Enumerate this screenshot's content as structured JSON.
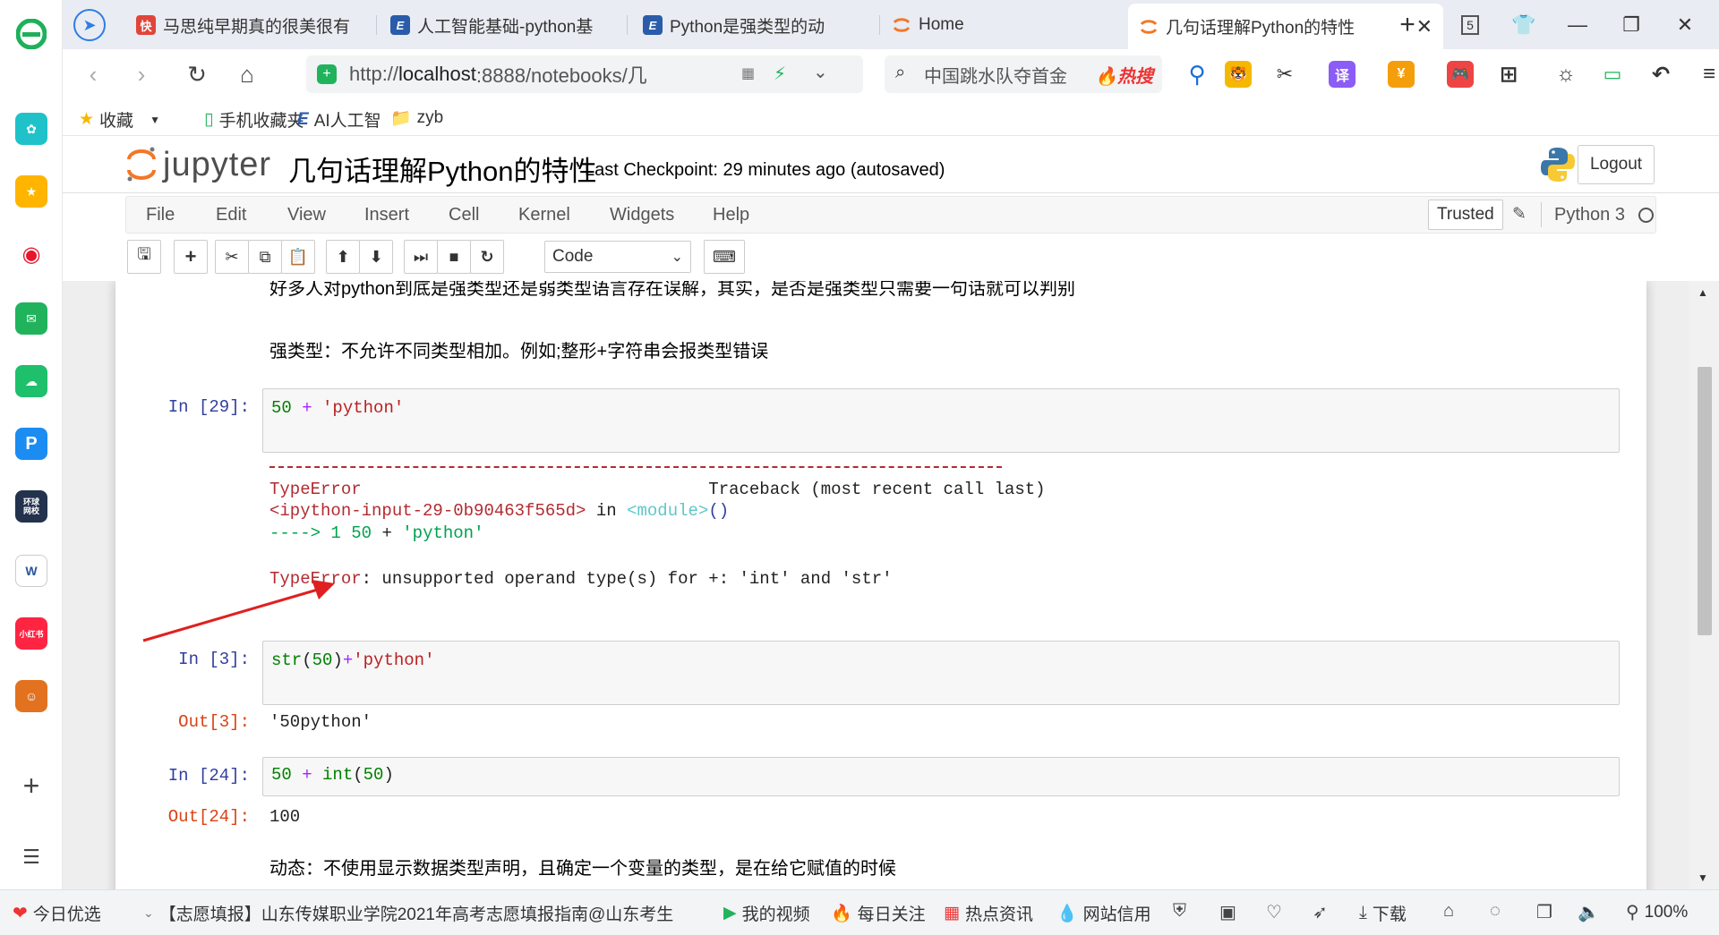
{
  "sidebar": {
    "icons": [
      "browser-logo-icon",
      "mini-program-icon",
      "favorites-star-icon",
      "weibo-icon",
      "mail-icon",
      "cloud-icon",
      "p-app-icon",
      "global-news-icon",
      "document-icon",
      "xiaohongshu-icon",
      "game-avatar-icon",
      "add-icon",
      "list-icon"
    ],
    "global_news_label": "环球\n网校",
    "xiaohongshu_label": "小红书"
  },
  "tabs": [
    {
      "label": "马思纯早期真的很美很有",
      "fav_color": "#e0453a",
      "fav_text": "快"
    },
    {
      "label": "人工智能基础-python基",
      "fav_color": "#2a5caa",
      "fav_text": "E"
    },
    {
      "label": "Python是强类型的动",
      "fav_color": "#2a5caa",
      "fav_text": "E"
    },
    {
      "label": "Home",
      "fav_color": "#f37726",
      "fav_text": ""
    },
    {
      "label": "几句话理解Python的特性",
      "fav_color": "#f37726",
      "fav_text": ""
    }
  ],
  "tab_count": "5",
  "nav": {
    "url_prefix": "http://",
    "url_host": "localhost",
    "url_rest": ":8888/notebooks/几",
    "search_text": "中国跳水队夺首金",
    "hot_label": "热搜"
  },
  "bookmarks": {
    "favorites": "收藏",
    "mobile": "手机收藏夹",
    "ai": "AI人工智",
    "folder": "zyb"
  },
  "jupyter": {
    "logo": "jupyter",
    "notebook_title": "几句话理解Python的特性",
    "checkpoint": "Last Checkpoint: 29 minutes ago (autosaved)",
    "logout": "Logout",
    "menus": [
      "File",
      "Edit",
      "View",
      "Insert",
      "Cell",
      "Kernel",
      "Widgets",
      "Help"
    ],
    "trusted": "Trusted",
    "kernel": "Python 3",
    "cell_type": "Code"
  },
  "cells": {
    "md1": "好多人对python到底是强类型还是弱类型语言存在误解，其实，是否是强类型只需要一句话就可以判别",
    "md2": "强类型：不允许不同类型相加。例如;整形+字符串会报类型错误",
    "c1_prompt": "In  [29]:",
    "c1_num": "50",
    "c1_op": "+",
    "c1_str": "'python'",
    "err_name": "TypeError",
    "err_traceback": "Traceback (most recent call last)",
    "err_input": "<ipython-input-29-0b90463f565d>",
    "err_in": "in",
    "err_module": "<module>",
    "err_parens": "()",
    "err_arrow": "----> 1",
    "err_line_num": "50",
    "err_line_op": "+",
    "err_line_str": "'python'",
    "err_final_name": "TypeError",
    "err_final_msg": ": unsupported operand type(s) for +: 'int' and 'str'",
    "c2_prompt": "In  [3]:",
    "c2_func": "str",
    "c2_open": "(",
    "c2_num": "50",
    "c2_close": ")",
    "c2_op": "+",
    "c2_str": "'python'",
    "c2_out_prompt": "Out[3]:",
    "c2_out": "'50python'",
    "c3_prompt": "In  [24]:",
    "c3_num": "50",
    "c3_op": "+",
    "c3_func": "int",
    "c3_open": "(",
    "c3_arg": "50",
    "c3_close": ")",
    "c3_out_prompt": "Out[24]:",
    "c3_out": "100",
    "md3": "动态：不使用显示数据类型声明，且确定一个变量的类型，是在给它赋值的时候"
  },
  "statusbar": {
    "today": "今日优选",
    "news": "【志愿填报】山东传媒职业学院2021年高考志愿填报指南@山东考生",
    "video": "我的视频",
    "daily": "每日关注",
    "hot": "热点资讯",
    "credit": "网站信用",
    "download": "下载",
    "zoom": "100%"
  }
}
